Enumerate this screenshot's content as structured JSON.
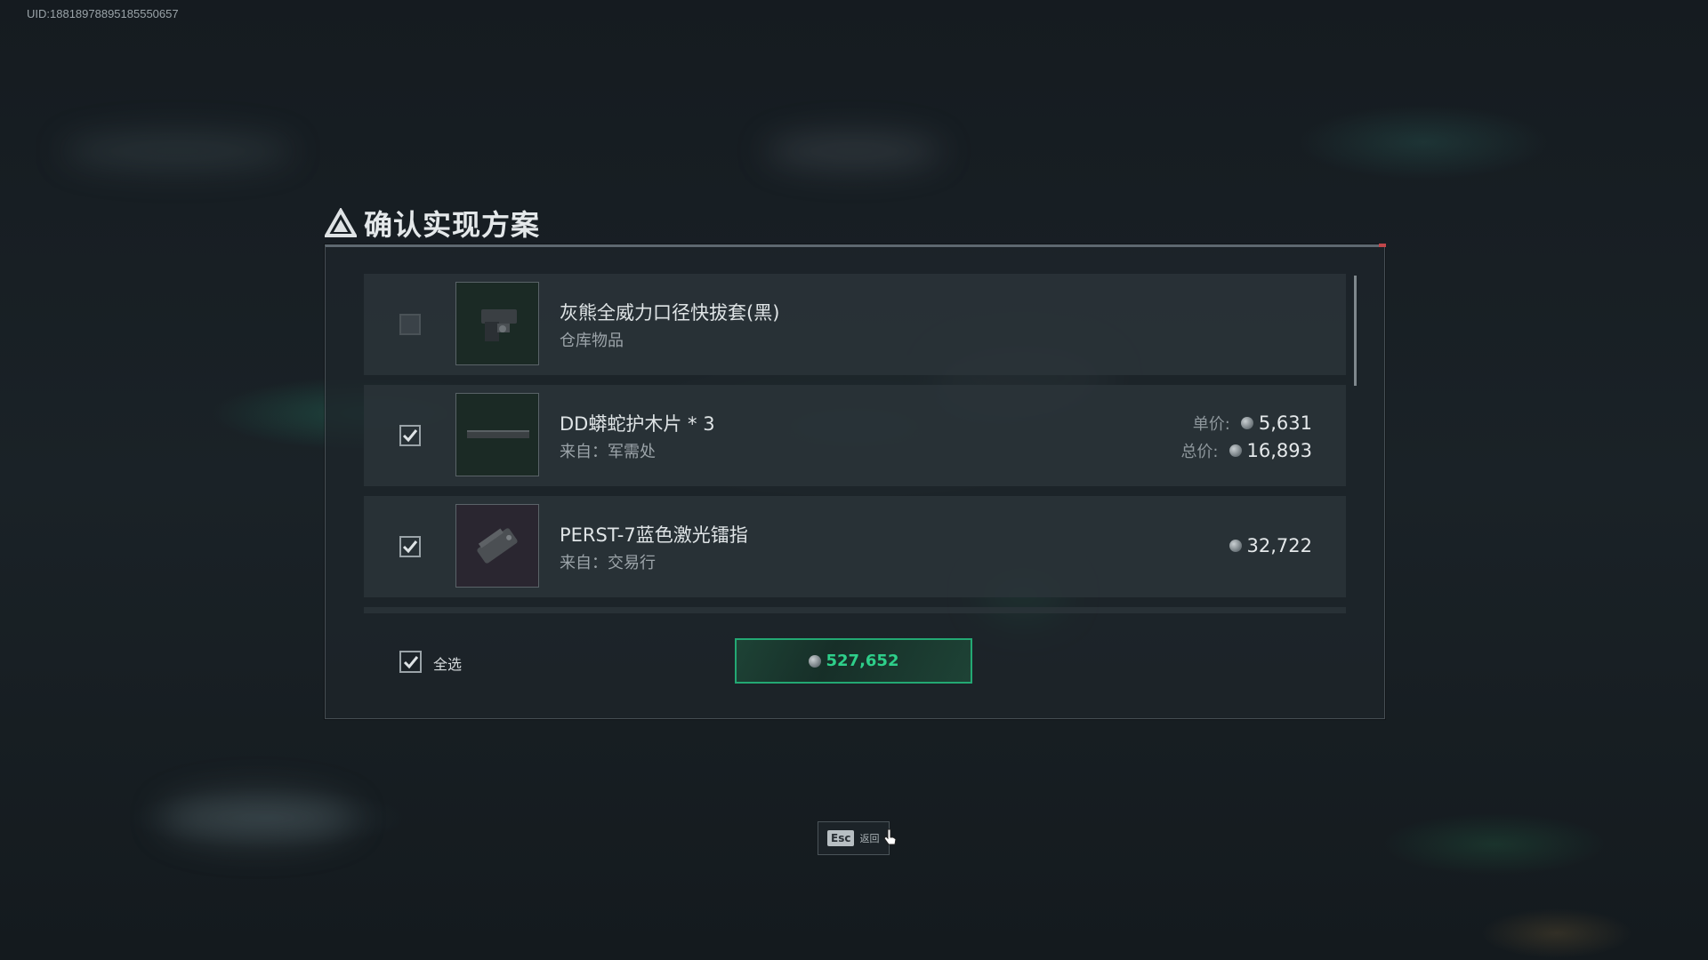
{
  "uid": "UID:18818978895185550657",
  "dialog": {
    "title": "确认实现方案"
  },
  "items": [
    {
      "name": "灰熊全威力口径快拔套(黑)",
      "source": "仓库物品",
      "checked": false,
      "disabled": true
    },
    {
      "name": "DD蟒蛇护木片 * 3",
      "source": "来自：军需处",
      "checked": true,
      "unit_label": "单价:",
      "unit_price": "5,631",
      "total_label": "总价:",
      "total_price": "16,893"
    },
    {
      "name": "PERST-7蓝色激光镭指",
      "source": "来自：交易行",
      "checked": true,
      "price": "32,722"
    }
  ],
  "footer": {
    "select_all_label": "全选",
    "select_all_checked": true,
    "total_value": "527,652"
  },
  "esc": {
    "key": "Esc",
    "label": "返回"
  },
  "colors": {
    "accent_green": "#2ecf8a",
    "border_green": "#23a873",
    "red_marker": "#c0464a"
  },
  "icons": [
    "triangle-logo-icon",
    "checkmark-icon",
    "coin-icon",
    "pointer-cursor-icon"
  ]
}
